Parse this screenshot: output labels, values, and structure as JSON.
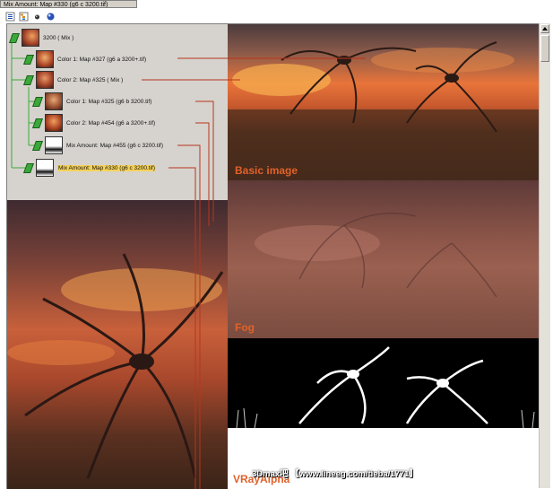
{
  "window": {
    "title": "Mix Amount: Map #330 (g6 c 3200.tif)"
  },
  "toolbar": {
    "icons": [
      "list-view-icon",
      "tree-view-icon",
      "small-sphere-icon",
      "render-sphere-icon"
    ]
  },
  "tree": {
    "nodes": [
      {
        "label": "3200  ( Mix )",
        "level": 0,
        "thumb": "sunset"
      },
      {
        "label": "Color 1: Map #327 (g6 a 3200+.tif)",
        "level": 1,
        "thumb": "sunset"
      },
      {
        "label": "Color 2: Map #325  ( Mix )",
        "level": 1,
        "thumb": "sunset"
      },
      {
        "label": "Color 1: Map #325 (g6 b 3200.tif)",
        "level": 2,
        "thumb": "sunset"
      },
      {
        "label": "Color 2: Map #454 (g6 a 3200+.tif)",
        "level": 2,
        "thumb": "sunset"
      },
      {
        "label": "Mix Amount: Map #455 (g6 c 3200.tif)",
        "level": 2,
        "thumb": "mask"
      },
      {
        "label": "Mix Amount: Map #330 (g6 c 3200.tif)",
        "level": 1,
        "thumb": "mask",
        "selected": true
      }
    ]
  },
  "panels": {
    "basic_label": "Basic image",
    "fog_label": "Fog",
    "alpha_label": "VRayAlpha"
  },
  "watermark": "3Dmax吧  【www.lineeg.com/tieba/1771】",
  "colors": {
    "accent_line": "#b8341c",
    "label_orange": "#e0622a",
    "selected_bg": "#f6d25a",
    "node_green": "#3aa83a"
  }
}
